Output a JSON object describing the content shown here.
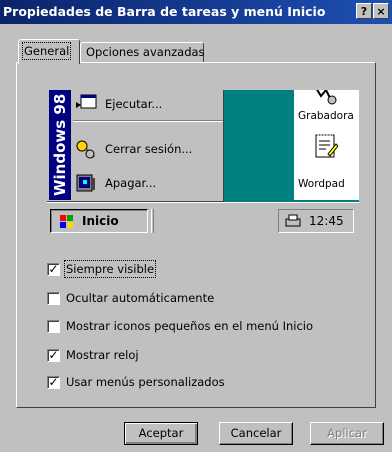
{
  "window": {
    "title": "Propiedades de Barra de tareas y menú Inicio",
    "help_glyph": "?",
    "close_glyph": "×"
  },
  "tabs": [
    {
      "label": "General",
      "active": true
    },
    {
      "label": "Opciones avanzadas",
      "active": false
    }
  ],
  "preview": {
    "banner_text": "Windows 98",
    "menu_items": [
      {
        "label": "Ejecutar...",
        "icon": "run-icon"
      },
      {
        "label": "Cerrar sesión...",
        "icon": "logoff-icon"
      },
      {
        "label": "Apagar...",
        "icon": "shutdown-icon"
      }
    ],
    "desktop_icons": [
      {
        "label": "Grabadora",
        "icon": "sound-recorder-icon"
      },
      {
        "label": "Wordpad",
        "icon": "wordpad-icon"
      }
    ],
    "start_button": "Inicio",
    "clock": "12:45",
    "teal": "#008080"
  },
  "options": [
    {
      "label": "Siempre visible",
      "checked": true
    },
    {
      "label": "Ocultar automáticamente",
      "checked": false
    },
    {
      "label": "Mostrar iconos pequeños en el menú Inicio",
      "checked": false
    },
    {
      "label": "Mostrar reloj",
      "checked": true
    },
    {
      "label": "Usar menús personalizados",
      "checked": true
    }
  ],
  "buttons": {
    "ok": "Aceptar",
    "cancel": "Cancelar",
    "apply": "Aplicar"
  },
  "colors": {
    "title_bar": "#0a246a",
    "face": "#c0c0c0"
  }
}
